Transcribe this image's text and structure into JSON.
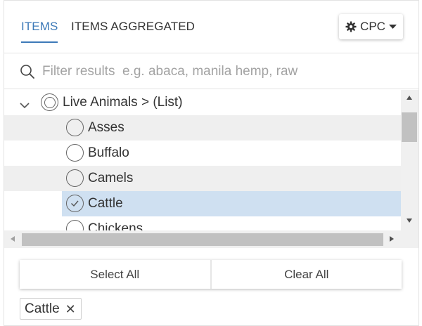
{
  "tabs": [
    {
      "label": "ITEMS",
      "active": true
    },
    {
      "label": "ITEMS AGGREGATED",
      "active": false
    }
  ],
  "classification": {
    "label": "CPC",
    "icon": "gear-icon"
  },
  "search": {
    "placeholder": "Filter results  e.g. abaca, manila hemp, raw",
    "value": ""
  },
  "tree": {
    "parent": {
      "label": "Live Animals > (List)",
      "expanded": true
    },
    "items": [
      {
        "label": "Asses",
        "selected": false
      },
      {
        "label": "Buffalo",
        "selected": false
      },
      {
        "label": "Camels",
        "selected": false
      },
      {
        "label": "Cattle",
        "selected": true
      },
      {
        "label": "Chickens",
        "selected": false
      }
    ]
  },
  "actions": {
    "select_all": "Select All",
    "clear_all": "Clear All"
  },
  "selected_chips": [
    {
      "label": "Cattle"
    }
  ],
  "colors": {
    "accent": "#3d7ab8",
    "selected_row": "#cfe0f1",
    "alt_row": "#efefef"
  }
}
